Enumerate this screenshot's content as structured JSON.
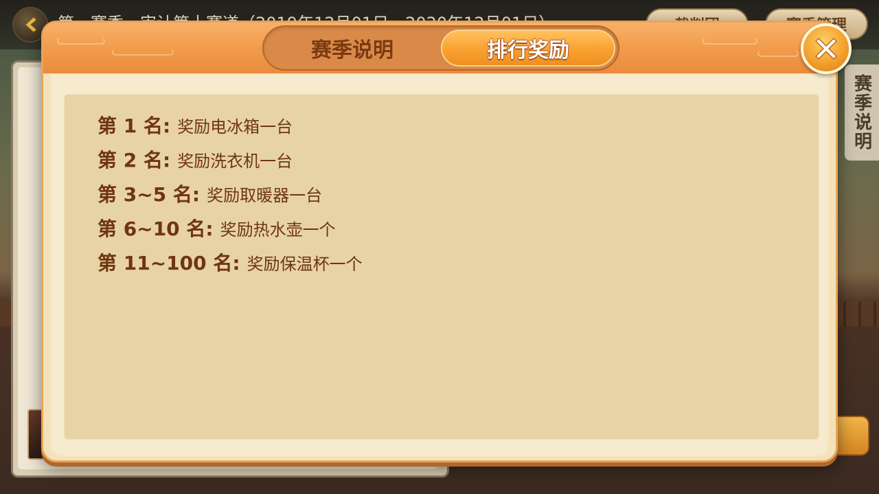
{
  "background": {
    "title": "第一赛季　审计第十赛道（2019年12月01日 - 2020年12月01日）",
    "top_buttons": [
      "裁判团",
      "赛季管理"
    ],
    "side_tab_label": "赛季说明"
  },
  "dialog": {
    "tabs": [
      {
        "label": "赛季说明",
        "active": false
      },
      {
        "label": "排行奖励",
        "active": true
      }
    ],
    "close_icon": "close-icon",
    "rewards": [
      {
        "rank": "第 1 名:",
        "prize": "奖励电冰箱一台"
      },
      {
        "rank": "第 2 名:",
        "prize": "奖励洗衣机一台"
      },
      {
        "rank": "第 3~5 名:",
        "prize": "奖励取暖器一台"
      },
      {
        "rank": "第 6~10 名:",
        "prize": "奖励热水壶一个"
      },
      {
        "rank": "第 11~100 名:",
        "prize": "奖励保温杯一个"
      }
    ]
  },
  "colors": {
    "accent_orange": "#f09a4a",
    "text_brown": "#6e3510",
    "panel_bg": "#e8d3a6"
  }
}
